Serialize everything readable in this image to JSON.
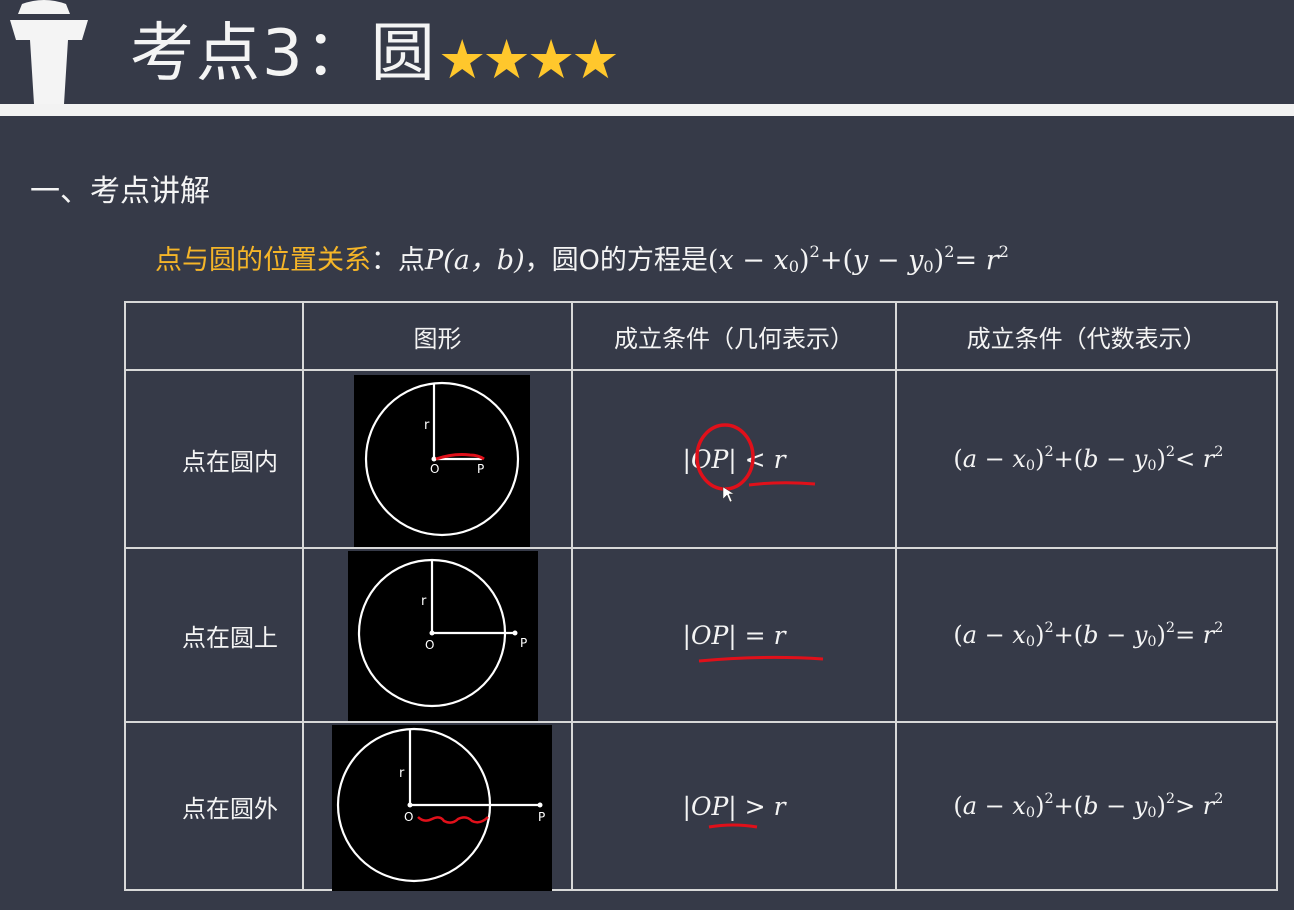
{
  "header": {
    "title": "考点3：圆",
    "stars": "★★★★",
    "colors": {
      "stars": "#ffc72c",
      "accent": "#f5b528",
      "background": "#363a48"
    }
  },
  "section_heading": "一、考点讲解",
  "intro": {
    "highlight": "点与圆的位置关系",
    "colon": "：点",
    "point": "P(a，b)",
    "text": "，圆O的方程是"
  },
  "table": {
    "headers": [
      "",
      "图形",
      "成立条件（几何表示）",
      "成立条件（代数表示）"
    ],
    "rows": [
      {
        "label": "点在圆内",
        "relation": "<"
      },
      {
        "label": "点在圆上",
        "relation": "="
      },
      {
        "label": "点在圆外",
        "relation": ">"
      }
    ],
    "diagram_labels": {
      "radius": "r",
      "center": "O",
      "point": "P"
    }
  },
  "annotation_color": "#e0101a"
}
